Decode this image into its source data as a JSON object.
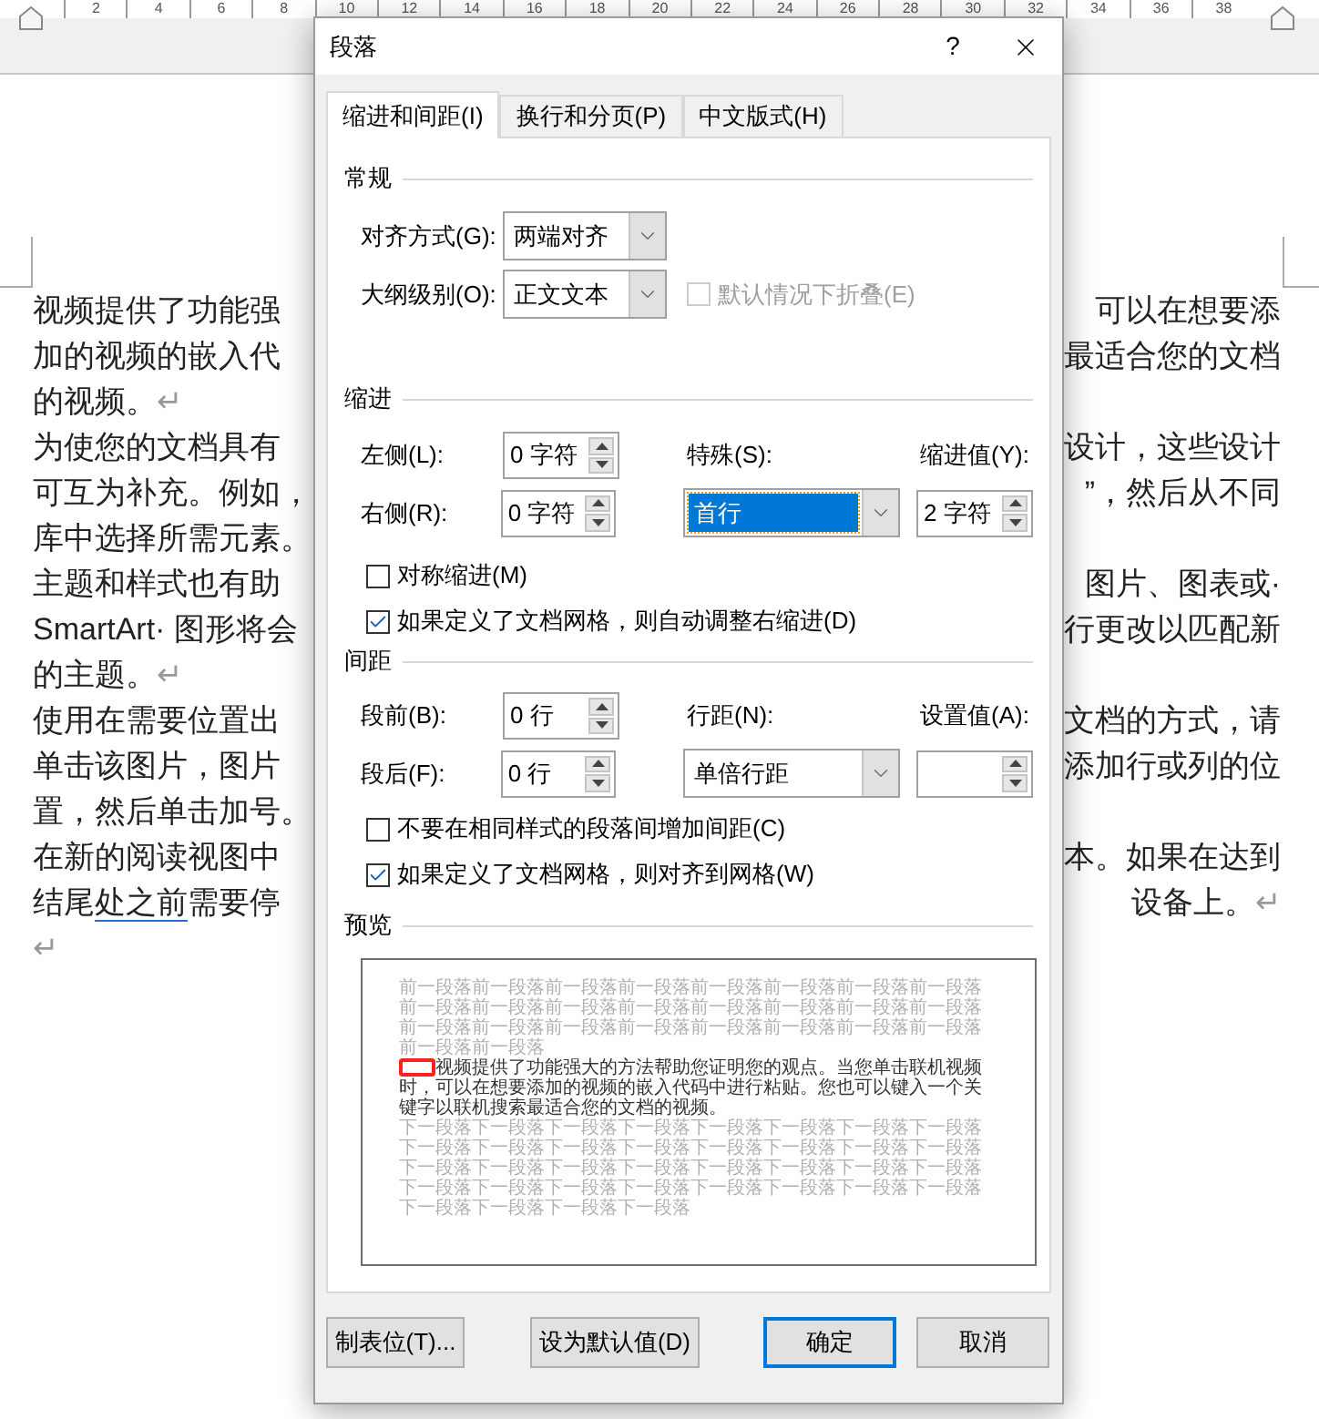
{
  "ruler": {
    "numbers": [
      "2",
      "4",
      "6",
      "8",
      "10",
      "12",
      "14",
      "16",
      "18",
      "20",
      "22",
      "24",
      "26",
      "28",
      "30",
      "32",
      "34",
      "36",
      "38"
    ]
  },
  "document": {
    "lines": [
      {
        "left": [
          {
            "text": "视频提供了功能强",
            "underlined": false
          }
        ],
        "right": "可以在想要添"
      },
      {
        "left": [
          {
            "text": "加的视频的嵌入代",
            "underlined": false
          }
        ],
        "right": "最适合您的文档"
      },
      {
        "left": [
          {
            "text": "的视频。",
            "underlined": false
          }
        ],
        "end_mark": "↵"
      },
      {
        "left": [
          {
            "text": "为使您的文档具有",
            "underlined": false
          }
        ],
        "right": "设计，这些设计"
      },
      {
        "left": [
          {
            "text": "可互为补充。例如，",
            "underlined": false
          }
        ],
        "right": "”，然后从不同"
      },
      {
        "left": [
          {
            "text": "库中选择所需元素。",
            "underlined": false
          }
        ]
      },
      {
        "left": [
          {
            "text": "主题和样式也有助",
            "underlined": false
          }
        ],
        "right": "图片、图表或·"
      },
      {
        "left": [
          {
            "text": "SmartArt· 图形将会",
            "underlined": false
          }
        ],
        "right": "行更改以匹配新"
      },
      {
        "left": [
          {
            "text": "的主题。",
            "underlined": false
          }
        ],
        "end_mark": "↵"
      },
      {
        "left": [
          {
            "text": "使用在需要位置出",
            "underlined": false
          }
        ],
        "right": "文档的方式，请"
      },
      {
        "left": [
          {
            "text": "单击该图片，图片",
            "underlined": false
          }
        ],
        "right": "添加行或列的位"
      },
      {
        "left": [
          {
            "text": "置，然后单击加号。",
            "underlined": false
          }
        ]
      },
      {
        "left": [
          {
            "text": "在新的阅读视图中",
            "underlined": false
          }
        ],
        "right": "本。如果在达到"
      },
      {
        "left": [
          {
            "text": "结尾",
            "underlined": false
          },
          {
            "text": "处之前",
            "underlined": true
          },
          {
            "text": "需要停",
            "underlined": false
          }
        ],
        "right": "设备上。",
        "end_mark": "↵"
      },
      {
        "end_mark": "↵"
      }
    ]
  },
  "dialog": {
    "title": "段落",
    "help_button": "?",
    "tabs": [
      {
        "label": "缩进和间距(I)",
        "selected": true
      },
      {
        "label": "换行和分页(P)",
        "selected": false
      },
      {
        "label": "中文版式(H)",
        "selected": false
      }
    ],
    "general": {
      "title": "常规",
      "alignment": {
        "label": "对齐方式(G):",
        "value": "两端对齐"
      },
      "outline_level": {
        "label": "大纲级别(O):",
        "value": "正文文本"
      },
      "collapse": {
        "label": "默认情况下折叠(E)",
        "checked": false,
        "disabled": true
      }
    },
    "indent": {
      "title": "缩进",
      "left": {
        "label": "左侧(L):",
        "value": "0 字符"
      },
      "right": {
        "label": "右侧(R):",
        "value": "0 字符"
      },
      "special": {
        "label": "特殊(S):",
        "value": "首行",
        "highlighted": true
      },
      "by": {
        "label": "缩进值(Y):",
        "value": "2 字符"
      },
      "checkboxes": [
        {
          "label": "对称缩进(M)",
          "checked": false
        },
        {
          "label": "如果定义了文档网格，则自动调整右缩进(D)",
          "checked": true
        }
      ]
    },
    "spacing": {
      "title": "间距",
      "before": {
        "label": "段前(B):",
        "value": "0 行"
      },
      "after": {
        "label": "段后(F):",
        "value": "0 行"
      },
      "line_spacing": {
        "label": "行距(N):",
        "value": "单倍行距"
      },
      "at": {
        "label": "设置值(A):"
      },
      "checkboxes": [
        {
          "label": "不要在相同样式的段落间增加间距(C)",
          "checked": false
        },
        {
          "label": "如果定义了文档网格，则对齐到网格(W)",
          "checked": true
        }
      ]
    },
    "preview": {
      "title": "预览",
      "previous": "前一段落前一段落前一段落前一段落前一段落前一段落前一段落前一段落前一段落前一段落前一段落前一段落前一段落前一段落前一段落前一段落前一段落前一段落前一段落前一段落前一段落前一段落前一段落前一段落前一段落前一段落",
      "current": "视频提供了功能强大的方法帮助您证明您的观点。当您单击联机视频时，可以在想要添加的视频的嵌入代码中进行粘贴。您也可以键入一个关键字以联机搜索最适合您的文档的视频。",
      "indent_highlighted": true,
      "next": "下一段落下一段落下一段落下一段落下一段落下一段落下一段落下一段落下一段落下一段落下一段落下一段落下一段落下一段落下一段落下一段落下一段落下一段落下一段落下一段落下一段落下一段落下一段落下一段落下一段落下一段落下一段落下一段落下一段落下一段落下一段落下一段落下一段落下一段落下一段落下一段落"
    },
    "buttons": [
      {
        "label": "制表位(T)...",
        "default": false
      },
      {
        "label": "设为默认值(D)",
        "default": false
      },
      {
        "label": "确定",
        "default": true
      },
      {
        "label": "取消",
        "default": false
      }
    ]
  }
}
